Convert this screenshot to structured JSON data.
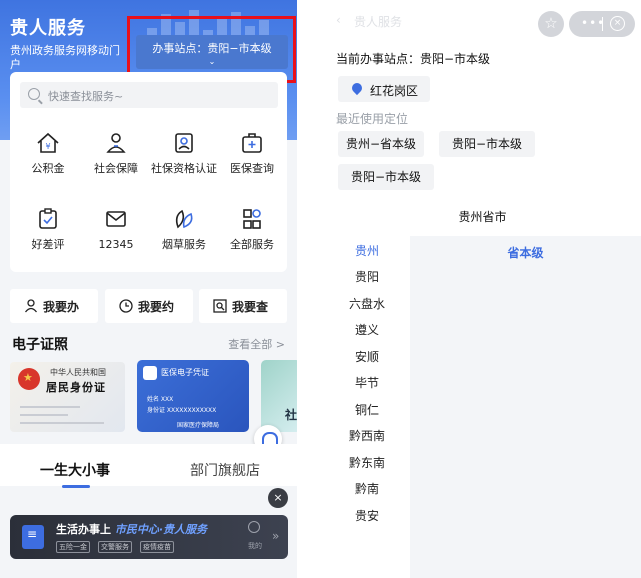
{
  "left": {
    "app_title": "贵人服务",
    "app_subtitle": "贵州政务服务网移动门户",
    "station_button": {
      "label": "办事站点：贵阳−市本级",
      "chevron": "⌄"
    },
    "search": {
      "placeholder": "快速查找服务~"
    },
    "grid": [
      {
        "label": "公积金",
        "icon": "house-yuan-icon"
      },
      {
        "label": "社会保障",
        "icon": "person-shield-icon"
      },
      {
        "label": "社保资格认证",
        "icon": "id-check-icon"
      },
      {
        "label": "医保查询",
        "icon": "medical-box-icon"
      },
      {
        "label": "好差评",
        "icon": "rating-clipboard-icon"
      },
      {
        "label": "12345",
        "icon": "envelope-icon"
      },
      {
        "label": "烟草服务",
        "icon": "leaf-icon"
      },
      {
        "label": "全部服务",
        "icon": "grid-apps-icon"
      }
    ],
    "actions": [
      {
        "label": "我要办",
        "icon": "person-icon"
      },
      {
        "label": "我要约",
        "icon": "clock-icon"
      },
      {
        "label": "我要查",
        "icon": "search-box-icon"
      }
    ],
    "certificates": {
      "title": "电子证照",
      "view_all": "查看全部 >",
      "id_card": {
        "line1": "中华人民共和国",
        "line2": "居民身份证"
      },
      "medical_card": {
        "title": "医保电子凭证",
        "name_row": "姓名    XXX",
        "id_row": "身份证  XXXXXXXXXXXX",
        "issuer": "国家医疗保障局"
      },
      "third_card_text": "社"
    },
    "tabs": [
      {
        "label": "一生大小事",
        "active": true
      },
      {
        "label": "部门旗舰店",
        "active": false
      }
    ],
    "close_glyph": "×",
    "banner": {
      "prefix": "生活办事上",
      "highlight": "市民中心·贵人服务",
      "chips": [
        "五险一金",
        "交警服务",
        "疫情疫苗"
      ],
      "me_label": "我的",
      "arrow": "»"
    }
  },
  "right": {
    "nav": {
      "back_glyph": "‹",
      "title": "贵人服务",
      "star_glyph": "☆",
      "more_glyph": "•••",
      "close_glyph": "×"
    },
    "current_station": "当前办事站点：贵阳−市本级",
    "location_chip": "红花岗区",
    "recent_label": "最近使用定位",
    "recent_chips": [
      "贵州−省本级",
      "贵阳−市本级",
      "贵阳−市本级"
    ],
    "province_title": "贵州省市",
    "cities": [
      "贵州",
      "贵阳",
      "六盘水",
      "遵义",
      "安顺",
      "毕节",
      "铜仁",
      "黔西南",
      "黔东南",
      "黔南",
      "贵安"
    ],
    "selected_city": "贵州",
    "levels": [
      "省本级"
    ]
  },
  "colors": {
    "brand_blue": "#3d6de0",
    "highlight_red": "#e8101a"
  }
}
